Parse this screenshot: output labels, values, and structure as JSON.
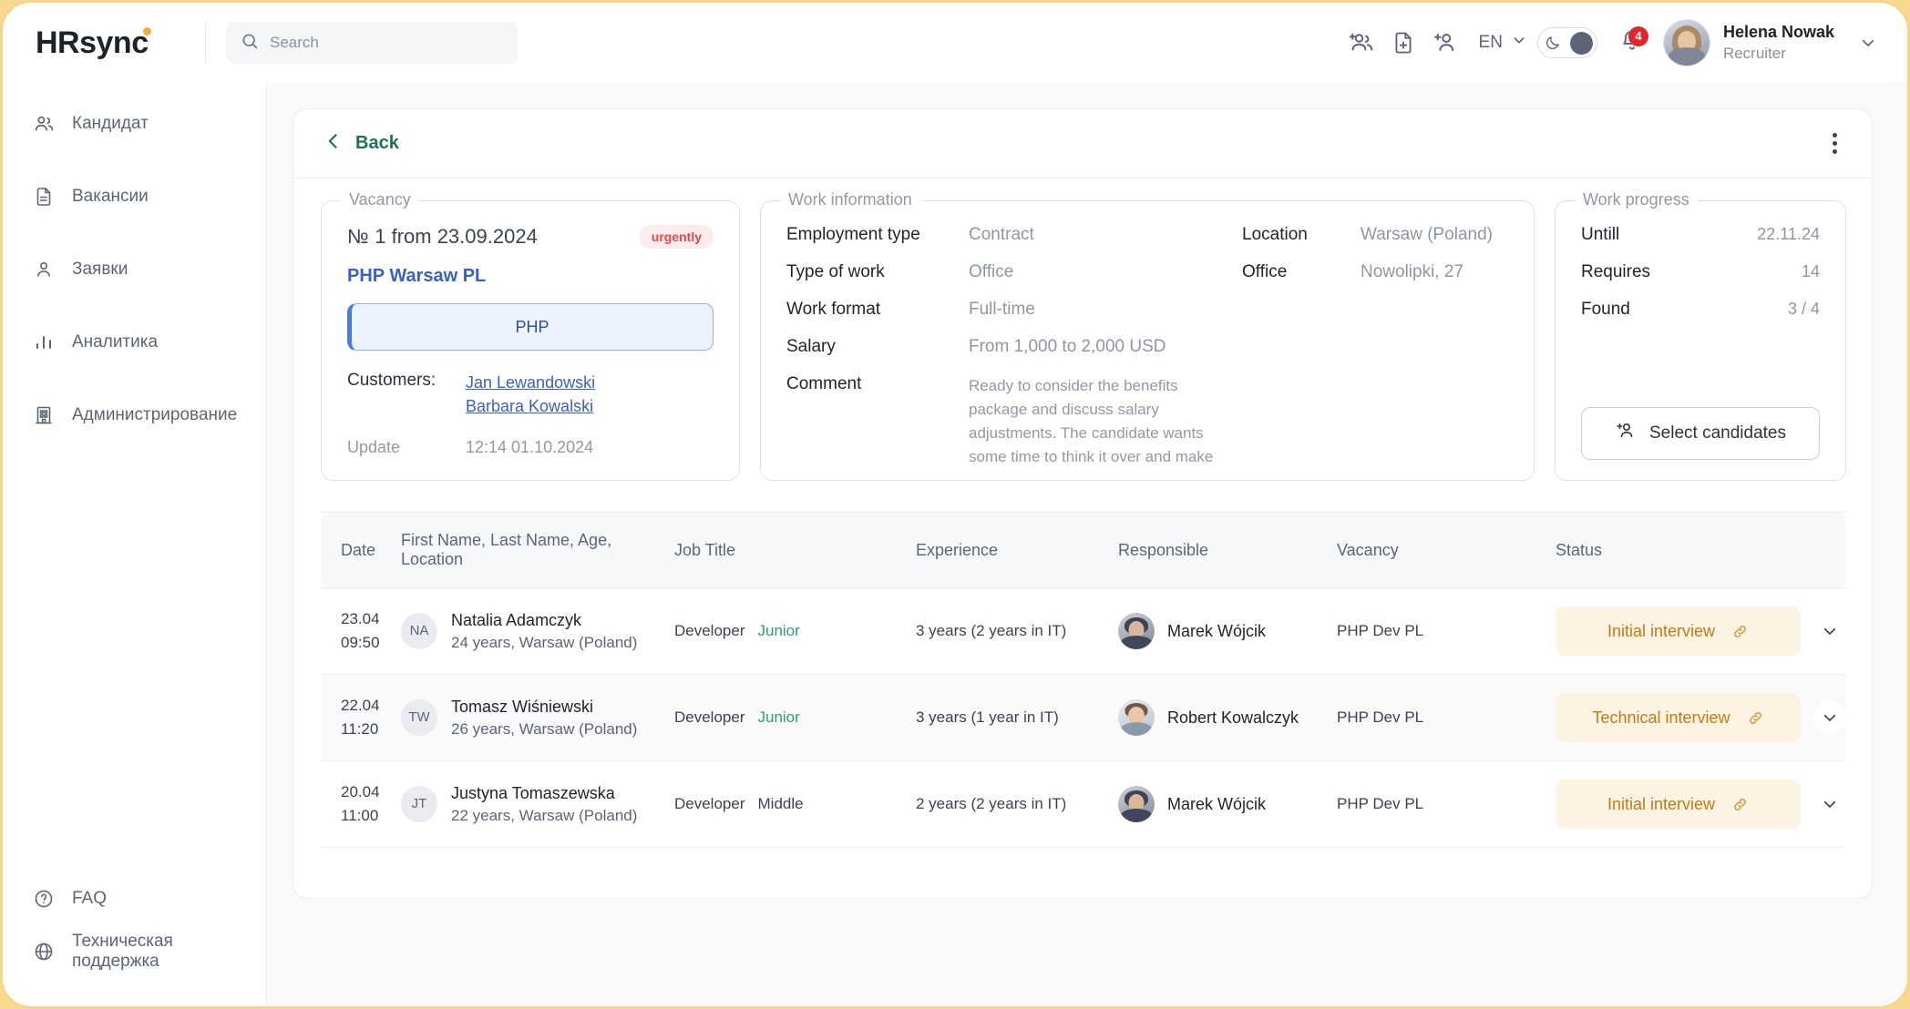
{
  "brand": {
    "name_part1": "HR",
    "name_part2": "sync"
  },
  "search": {
    "placeholder": "Search",
    "value": ""
  },
  "header": {
    "icons": [
      "add-group-icon",
      "add-document-icon",
      "add-person-icon"
    ],
    "language": "EN",
    "notifications_count": "4",
    "user": {
      "name": "Helena Nowak",
      "role": "Recruiter"
    }
  },
  "sidebar": {
    "items": [
      {
        "label": "Кандидат",
        "icon": "users-icon"
      },
      {
        "label": "Вакансии",
        "icon": "document-icon"
      },
      {
        "label": "Заявки",
        "icon": "person-icon"
      },
      {
        "label": "Аналитика",
        "icon": "bar-chart-icon"
      },
      {
        "label": "Администрирование",
        "icon": "building-icon"
      }
    ],
    "bottom_items": [
      {
        "label": "FAQ",
        "icon": "question-circle-icon"
      },
      {
        "label": "Техническая поддержка",
        "icon": "globe-icon"
      }
    ]
  },
  "page": {
    "back_label": "Back"
  },
  "vacancy": {
    "legend": "Vacancy",
    "number_prefix": "№",
    "number_text": "1 from 23.09.2024",
    "urgency_badge": "urgently",
    "title": "PHP Warsaw PL",
    "tag": "PHP",
    "customers_label": "Customers:",
    "customers": [
      "Jan Lewandowski",
      "Barbara Kowalski"
    ],
    "update_label": "Update",
    "update_value": "12:14 01.10.2024"
  },
  "work_information": {
    "legend": "Work information",
    "left_rows": [
      {
        "label": "Employment type",
        "value": "Contract"
      },
      {
        "label": "Type of work",
        "value": "Office"
      },
      {
        "label": "Work format",
        "value": "Full-time"
      },
      {
        "label": "Salary",
        "value": "From 1,000 to 2,000 USD"
      }
    ],
    "comment_label": "Comment",
    "comment_text": "Ready to consider the benefits package and discuss salary adjustments. The candidate wants some time to think it over and make a decision. They are considering offers from other companies and attending interviews. Overall, the impression of the candidate is positive, and we would like to move forward.",
    "right_rows": [
      {
        "label": "Location",
        "value": "Warsaw (Poland)"
      },
      {
        "label": "Office",
        "value": "Nowolipki, 27"
      }
    ]
  },
  "work_progress": {
    "legend": "Work progress",
    "rows": [
      {
        "label": "Untill",
        "value": "22.11.24"
      },
      {
        "label": "Requires",
        "value": "14"
      },
      {
        "label": "Found",
        "value": "3 / 4"
      }
    ],
    "button_label": "Select candidates"
  },
  "table": {
    "columns": [
      "Date",
      "First Name, Last Name, Age, Location",
      "Job Title",
      "Experience",
      "Responsible",
      "Vacancy",
      "Status"
    ],
    "rows": [
      {
        "date_day": "23.04",
        "date_time": "09:50",
        "initials": "NA",
        "name": "Natalia Adamczyk",
        "sub": "24 years, Warsaw (Poland)",
        "job_title": "Developer",
        "level": "Junior",
        "level_color": "green",
        "experience": "3 years (2 years in IT)",
        "responsible": "Marek Wójcik",
        "responsible_photo": "male-1",
        "vacancy": "PHP Dev PL",
        "status": "Initial interview"
      },
      {
        "date_day": "22.04",
        "date_time": "11:20",
        "initials": "TW",
        "name": "Tomasz Wiśniewski",
        "sub": "26 years, Warsaw (Poland)",
        "job_title": "Developer",
        "level": "Junior",
        "level_color": "green",
        "experience": "3 years (1 year in IT)",
        "responsible": "Robert Kowalczyk",
        "responsible_photo": "male-2",
        "vacancy": "PHP Dev PL",
        "status": "Technical interview"
      },
      {
        "date_day": "20.04",
        "date_time": "11:00",
        "initials": "JT",
        "name": "Justyna Tomaszewska",
        "sub": "22 years, Warsaw (Poland)",
        "job_title": "Developer",
        "level": "Middle",
        "level_color": "gray",
        "experience": "2 years (2 years in IT)",
        "responsible": "Marek Wójcik",
        "responsible_photo": "male-1",
        "vacancy": "PHP Dev PL",
        "status": "Initial interview"
      }
    ]
  },
  "colors": {
    "frame": "#F6D489",
    "accent_green": "#1F6F5C",
    "link_blue": "#3C5FC4",
    "urgent_red": "#E2484F",
    "status_amber_text": "#C07A18",
    "status_amber_bg": "#FDF3E3",
    "logo_dot_orange": "#F3AE3D"
  }
}
